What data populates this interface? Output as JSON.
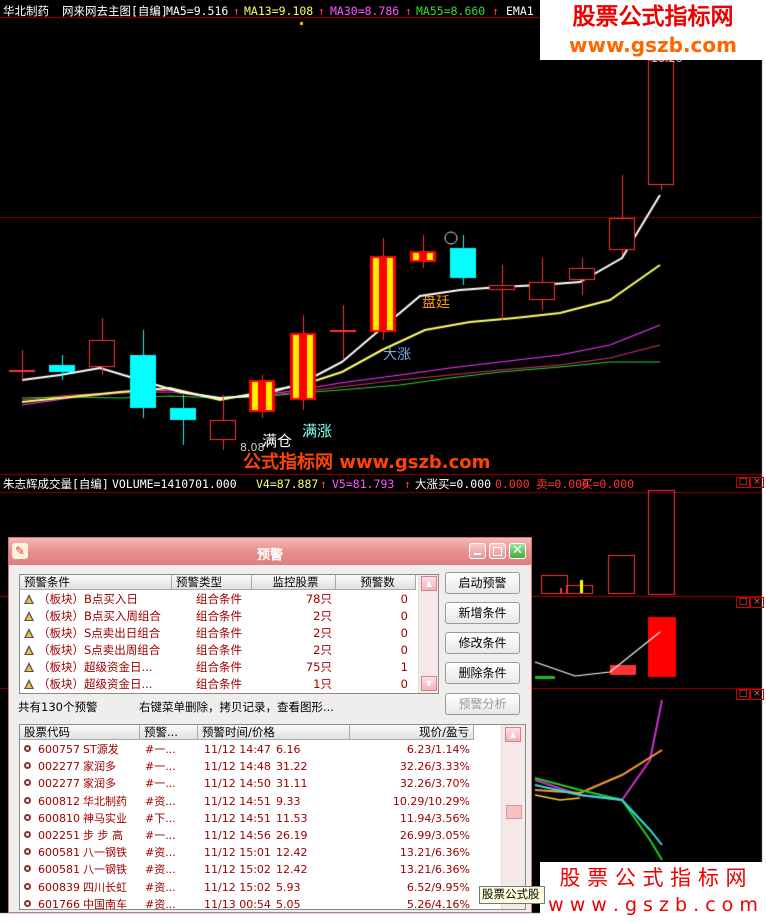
{
  "top_header": {
    "stock": "华北制药",
    "indicator": "网来网去主图[自编]",
    "ma5": "MA5=9.516",
    "ma13": "MA13=9.108",
    "ma30": "MA30=8.786",
    "ma55": "MA55=8.660",
    "ema": "EMA1",
    "arrow": "↑"
  },
  "chart_labels": {
    "min_price": "8.08",
    "full_position": "满仓",
    "limit_up_text": "满涨",
    "big_rise": "大涨",
    "consolidate": "盘廷",
    "watermark_center": "公式指标网  www.gszb.com",
    "top_value": "16.26"
  },
  "volume_header": {
    "indicator": "朱志辉成交量[自编]",
    "volume": "VOLUME=1410701.000",
    "v4": "V4=87.887",
    "v5": "V5=81.793",
    "bigrise_buy": "大涨买=0.000",
    "value2": "0.000",
    "sell": "卖=0.000",
    "buy": "买=0.000",
    "arrow": "↑"
  },
  "watermark_top": {
    "line1": "股票公式指标网",
    "line2": "www.gszb.com"
  },
  "watermark_bottom": {
    "line1": "股 票 公 式 指 标 网",
    "line2": "w w w . g s z b . c o m"
  },
  "colors": {
    "bg": "#000000",
    "up": "#ff0000",
    "down": "#00ffff",
    "ma5": "#ffffff",
    "ma13": "#ffff66",
    "ma30": "#ff33ff",
    "ma55": "#33cc33",
    "dialog_title": "#e98f8f"
  },
  "dialog": {
    "title": "预警",
    "conditions_headers": [
      "预警条件",
      "预警类型",
      "监控股票",
      "预警数"
    ],
    "conditions": [
      {
        "name": "（板块）B点买入日",
        "type": "组合条件",
        "stocks": "78只",
        "count": "0"
      },
      {
        "name": "（板块）B点买入周组合",
        "type": "组合条件",
        "stocks": "2只",
        "count": "0"
      },
      {
        "name": "（板块）S点卖出日组合",
        "type": "组合条件",
        "stocks": "2只",
        "count": "0"
      },
      {
        "name": "（板块）S点卖出周组合",
        "type": "组合条件",
        "stocks": "2只",
        "count": "0"
      },
      {
        "name": "（板块）超级资金日...",
        "type": "组合条件",
        "stocks": "75只",
        "count": "1"
      },
      {
        "name": "（板块）超级资金日...",
        "type": "组合条件",
        "stocks": "1只",
        "count": "0"
      }
    ],
    "summary": "共有130个预警",
    "hint": "右键菜单删除，拷贝记录，查看图形...",
    "buttons": [
      "启动预警",
      "新增条件",
      "修改条件",
      "删除条件",
      "预警分析"
    ],
    "alerts_headers": [
      "股票代码",
      "预警...",
      "预警时间/价格",
      "现价/盈亏"
    ],
    "alerts": [
      {
        "code": "600757",
        "name": "ST源发",
        "cond": "#一...",
        "time": "11/12 14:47",
        "price": "6.16",
        "pnl": "6.23/1.14%"
      },
      {
        "code": "002277",
        "name": "家润多",
        "cond": "#一...",
        "time": "11/12 14:48",
        "price": "31.22",
        "pnl": "32.26/3.33%"
      },
      {
        "code": "002277",
        "name": "家润多",
        "cond": "#一...",
        "time": "11/12 14:50",
        "price": "31.11",
        "pnl": "32.26/3.70%"
      },
      {
        "code": "600812",
        "name": "华北制药",
        "cond": "#资...",
        "time": "11/12 14:51",
        "price": "9.33",
        "pnl": "10.29/10.29%"
      },
      {
        "code": "600810",
        "name": "神马实业",
        "cond": "#下...",
        "time": "11/12 14:51",
        "price": "11.53",
        "pnl": "11.94/3.56%"
      },
      {
        "code": "002251",
        "name": "步 步 高",
        "cond": "#一...",
        "time": "11/12 14:56",
        "price": "26.19",
        "pnl": "26.99/3.05%"
      },
      {
        "code": "600581",
        "name": "八一钢铁",
        "cond": "#资...",
        "time": "11/12 15:01",
        "price": "12.42",
        "pnl": "13.21/6.36%"
      },
      {
        "code": "600581",
        "name": "八一钢铁",
        "cond": "#资...",
        "time": "11/12 15:02",
        "price": "12.42",
        "pnl": "13.21/6.36%"
      },
      {
        "code": "600839",
        "name": "四川长虹",
        "cond": "#资...",
        "time": "11/12 15:02",
        "price": "5.93",
        "pnl": "6.52/9.95%"
      },
      {
        "code": "601766",
        "name": "中国南车",
        "cond": "#资...",
        "time": "11/13 00:54",
        "price": "5.05",
        "pnl": "5.26/4.16%"
      }
    ],
    "tooltip": "股票公式股"
  }
}
